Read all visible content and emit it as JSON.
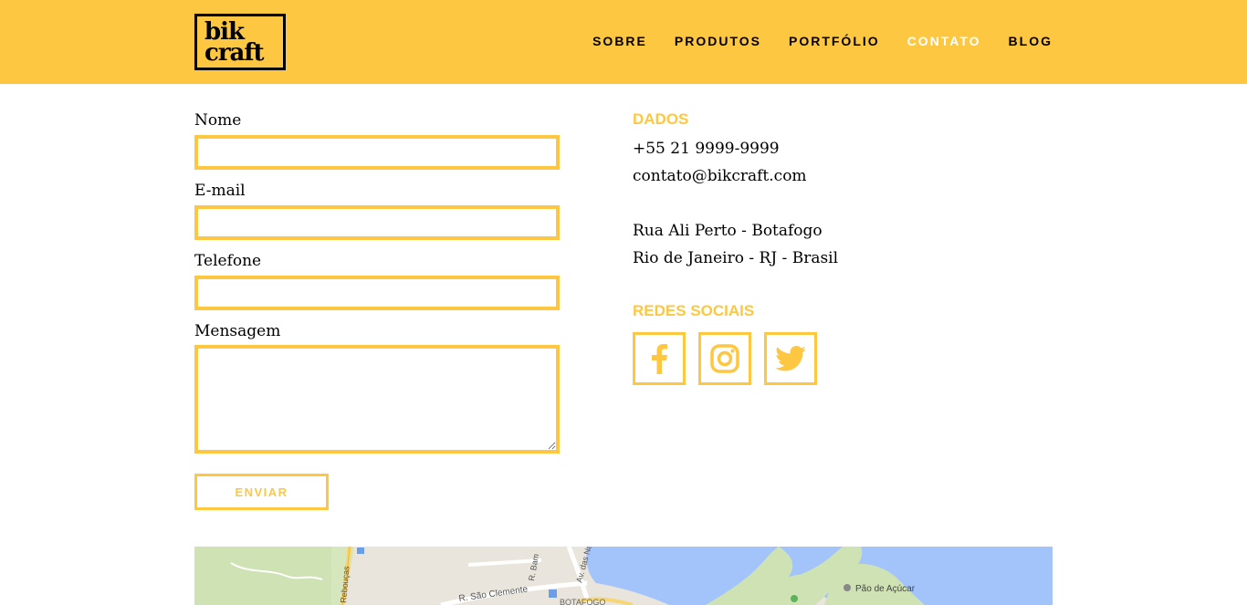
{
  "brand": {
    "line1": "bik",
    "line2": "craft"
  },
  "nav": [
    {
      "label": "SOBRE"
    },
    {
      "label": "PRODUTOS"
    },
    {
      "label": "PORTFÓLIO"
    },
    {
      "label": "CONTATO"
    },
    {
      "label": "BLOG"
    }
  ],
  "nav_active_index": 3,
  "form": {
    "name_label": "Nome",
    "email_label": "E-mail",
    "phone_label": "Telefone",
    "message_label": "Mensagem",
    "submit_label": "ENVIAR"
  },
  "contact": {
    "heading": "DADOS",
    "phone": "+55 21 9999-9999",
    "email": "contato@bikcraft.com",
    "address1": "Rua Ali Perto - Botafogo",
    "address2": "Rio de Janeiro - RJ - Brasil"
  },
  "social": {
    "heading": "REDES SOCIAIS",
    "icons": [
      "facebook-icon",
      "instagram-icon",
      "twitter-icon"
    ]
  },
  "map": {
    "street1": "R. São Clemente",
    "street2": "Av. das Nações",
    "street3": "R. Bam",
    "street4": "Rebouças",
    "poi": "Pão de Açúcar",
    "district": "BOTAFOGO"
  },
  "colors": {
    "accent": "#fec742",
    "text": "#000000",
    "active_nav": "#ffffff"
  }
}
